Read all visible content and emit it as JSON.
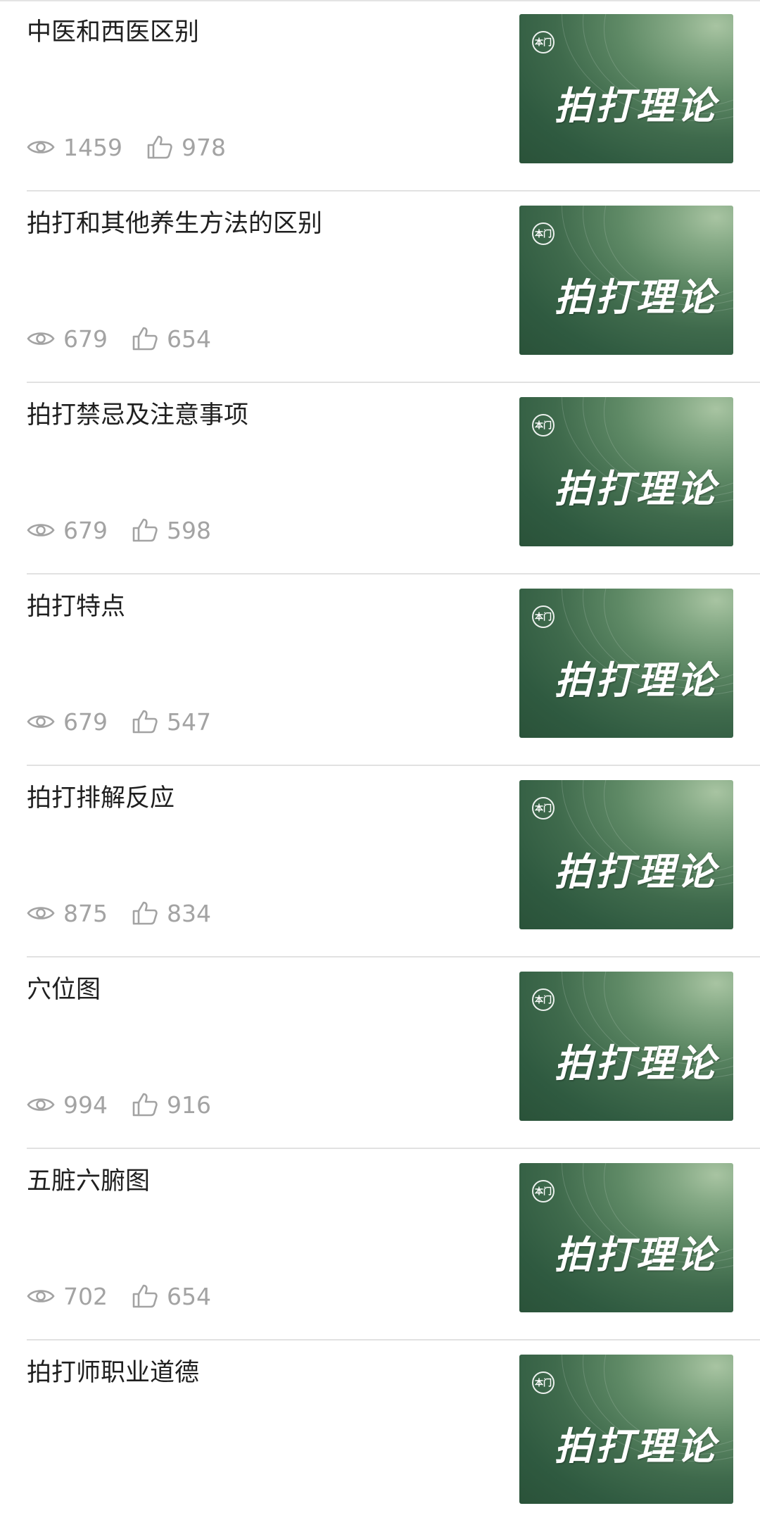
{
  "icons": {
    "views": "eye-icon",
    "likes": "thumbs-up-icon"
  },
  "colors": {
    "title": "#1f1f1f",
    "meta": "#a3a3a3",
    "divider": "#e1e1e1",
    "thumb_green_dark": "#2a5239",
    "thumb_green_light": "#a8c4a2"
  },
  "thumbnail": {
    "seal_text": "本门",
    "title_text": "拍打理论"
  },
  "articles": [
    {
      "title": "中医和西医区别",
      "views": "1459",
      "likes": "978"
    },
    {
      "title": "拍打和其他养生方法的区别",
      "views": "679",
      "likes": "654"
    },
    {
      "title": "拍打禁忌及注意事项",
      "views": "679",
      "likes": "598"
    },
    {
      "title": "拍打特点",
      "views": "679",
      "likes": "547"
    },
    {
      "title": "拍打排解反应",
      "views": "875",
      "likes": "834"
    },
    {
      "title": "穴位图",
      "views": "994",
      "likes": "916"
    },
    {
      "title": "五脏六腑图",
      "views": "702",
      "likes": "654"
    },
    {
      "title": "拍打师职业道德",
      "views": "",
      "likes": ""
    }
  ]
}
